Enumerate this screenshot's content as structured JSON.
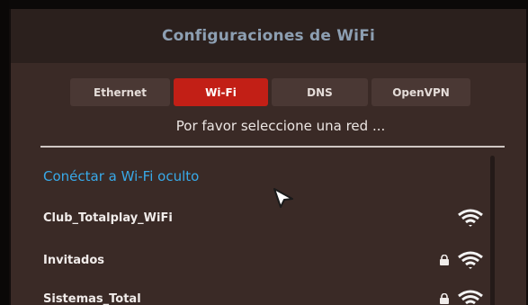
{
  "window": {
    "title": "Configuraciones de WiFi"
  },
  "tabs": [
    {
      "label": "Ethernet",
      "active": false
    },
    {
      "label": "Wi-Fi",
      "active": true
    },
    {
      "label": "DNS",
      "active": false
    },
    {
      "label": "OpenVPN",
      "active": false
    }
  ],
  "prompt": "Por favor seleccione una red ...",
  "hidden_network_link": "Conéctar a Wi-Fi oculto",
  "networks": [
    {
      "name": "Club_Totalplay_WiFi",
      "secured": false,
      "icon": "wifi-icon"
    },
    {
      "name": "Invitados",
      "secured": true,
      "icon": "wifi-icon"
    },
    {
      "name": "Sistemas_Total",
      "secured": true,
      "icon": "wifi-icon"
    }
  ],
  "colors": {
    "active_tab": "#c21f16",
    "link": "#38a9e8",
    "title": "#8d9fb2",
    "dialog_bg": "#3a2a26"
  }
}
